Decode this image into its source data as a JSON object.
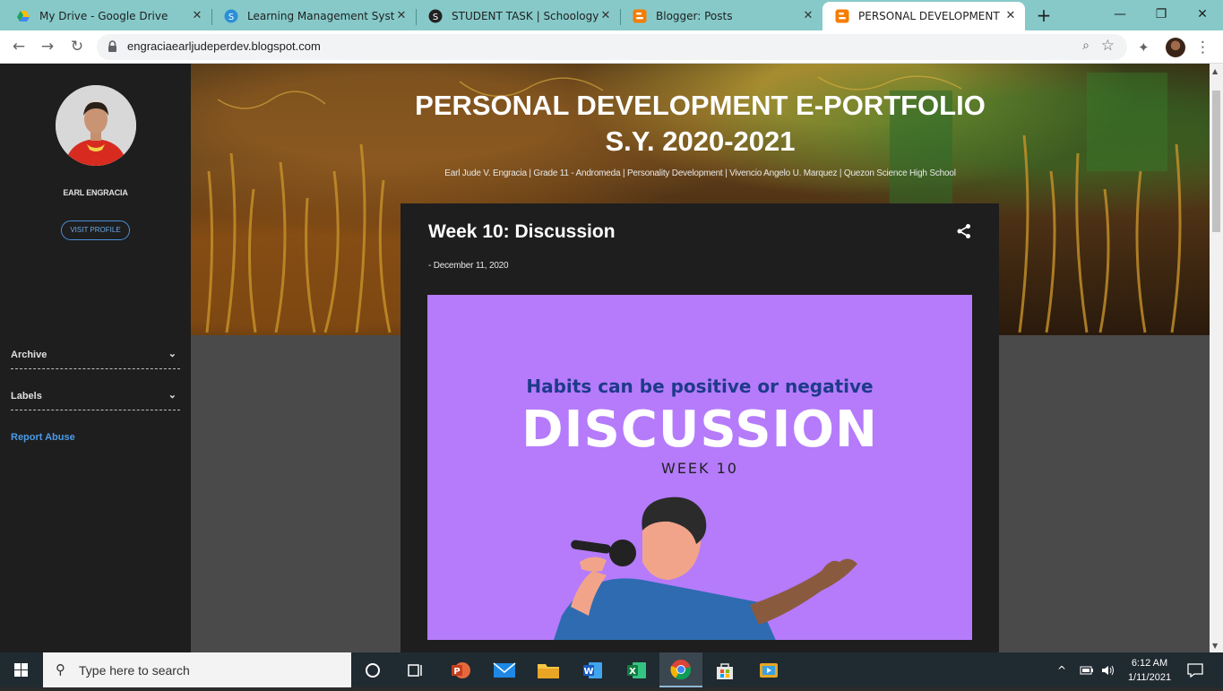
{
  "browser": {
    "tabs": [
      {
        "label": "My Drive - Google Drive",
        "icon": "google-drive-icon"
      },
      {
        "label": "Learning Management System",
        "icon": "lms-icon"
      },
      {
        "label": "STUDENT TASK | Schoology",
        "icon": "schoology-icon"
      },
      {
        "label": "Blogger: Posts",
        "icon": "blogger-icon"
      },
      {
        "label": "PERSONAL DEVELOPMENT E-PORTFOLIO",
        "icon": "blogger-icon",
        "active": true
      }
    ],
    "url": "engraciaearljudeperdev.blogspot.com",
    "accent": "#87c9c9"
  },
  "sidebar": {
    "profile_name": "EARL ENGRACIA",
    "visit_profile": "VISIT PROFILE",
    "items": [
      {
        "label": "Archive"
      },
      {
        "label": "Labels"
      }
    ],
    "report_abuse": "Report Abuse"
  },
  "header": {
    "title_line1": "PERSONAL DEVELOPMENT E-PORTFOLIO",
    "title_line2": "S.Y. 2020-2021",
    "subtitle": "Earl Jude V. Engracia | Grade 11 - Andromeda | Personality Development | Vivencio Angelo U. Marquez | Quezon Science High School"
  },
  "post": {
    "title": "Week 10: Discussion",
    "date": "- December 11, 2020",
    "image": {
      "habits": "Habits can be positive or negative",
      "discussion": "DISCUSSION",
      "week": "WEEK 10"
    }
  },
  "taskbar": {
    "search_placeholder": "Type here to search",
    "time": "6:12 AM",
    "date": "1/11/2021"
  }
}
